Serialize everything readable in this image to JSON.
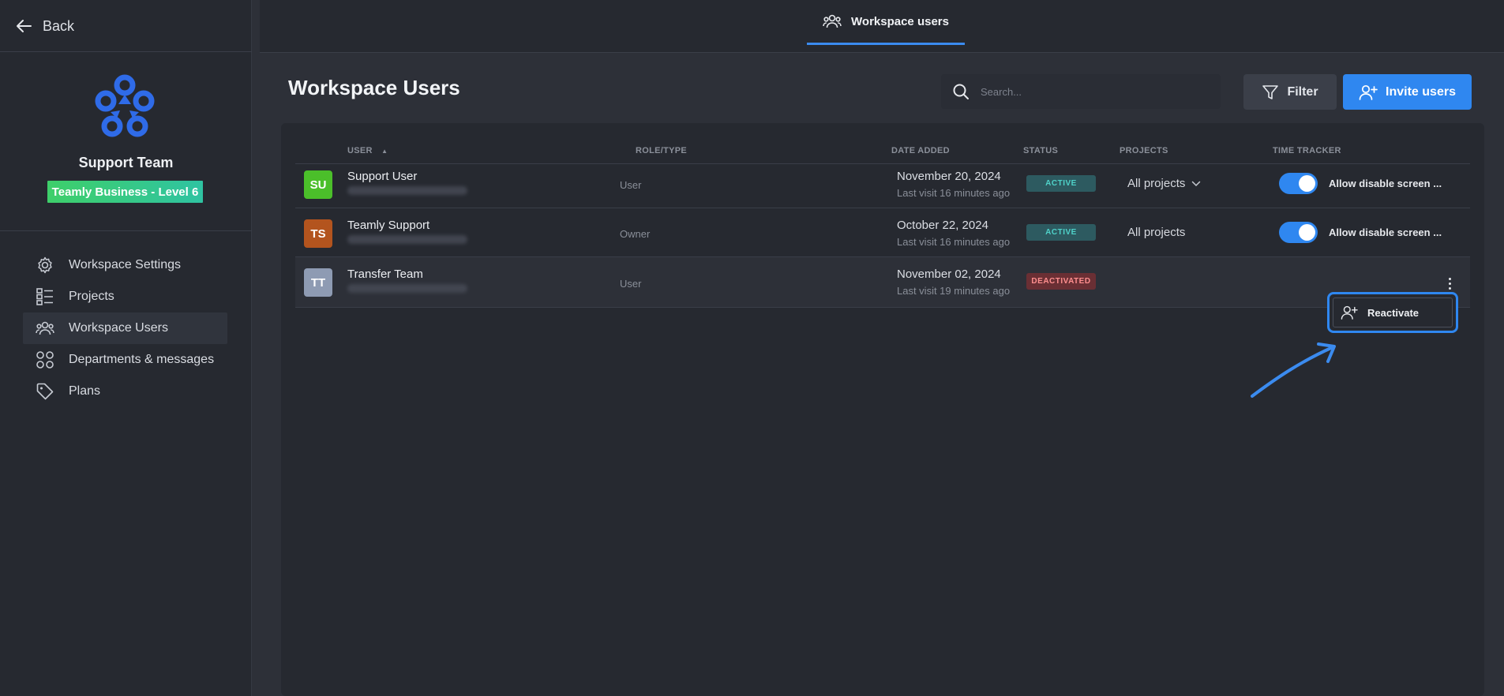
{
  "sidebar": {
    "back_label": "Back",
    "team_name": "Support Team",
    "plan_badge": "Teamly Business - Level 6",
    "items": [
      {
        "label": "Workspace Settings",
        "icon": "gear-icon"
      },
      {
        "label": "Projects",
        "icon": "list-icon"
      },
      {
        "label": "Workspace Users",
        "icon": "users-icon",
        "active": true
      },
      {
        "label": "Departments & messages",
        "icon": "grid-circles-icon"
      },
      {
        "label": "Plans",
        "icon": "tag-icon"
      }
    ]
  },
  "topbar": {
    "tab_label": "Workspace users"
  },
  "main": {
    "title": "Workspace Users",
    "search_placeholder": "Search...",
    "filter_label": "Filter",
    "invite_label": "Invite users"
  },
  "table": {
    "headers": [
      "USER",
      "ROLE/TYPE",
      "DATE ADDED",
      "STATUS",
      "PROJECTS",
      "TIME TRACKER"
    ],
    "rows": [
      {
        "initials": "SU",
        "name": "Support User",
        "role": "User",
        "date": "November 20, 2024",
        "last_visit": "Last visit 16 minutes ago",
        "status": "ACTIVE",
        "projects": "All projects",
        "tracker": "Allow disable screen ...",
        "avatar_color": "#4bbf2a"
      },
      {
        "initials": "TS",
        "name": "Teamly Support",
        "role": "Owner",
        "date": "October 22, 2024",
        "last_visit": "Last visit 16 minutes ago",
        "status": "ACTIVE",
        "projects": "All projects",
        "tracker": "Allow disable screen ...",
        "avatar_color": "#b3541e"
      },
      {
        "initials": "TT",
        "name": "Transfer Team",
        "role": "User",
        "date": "November 02, 2024",
        "last_visit": "Last visit 19 minutes ago",
        "status": "DEACTIVATED",
        "avatar_color": "#8e9bb3"
      }
    ]
  },
  "context_menu": {
    "reactivate_label": "Reactivate"
  },
  "colors": {
    "accent": "#2f87f0",
    "active_status": "#4fd2c9",
    "deactivated_status": "#ff8f8f"
  }
}
